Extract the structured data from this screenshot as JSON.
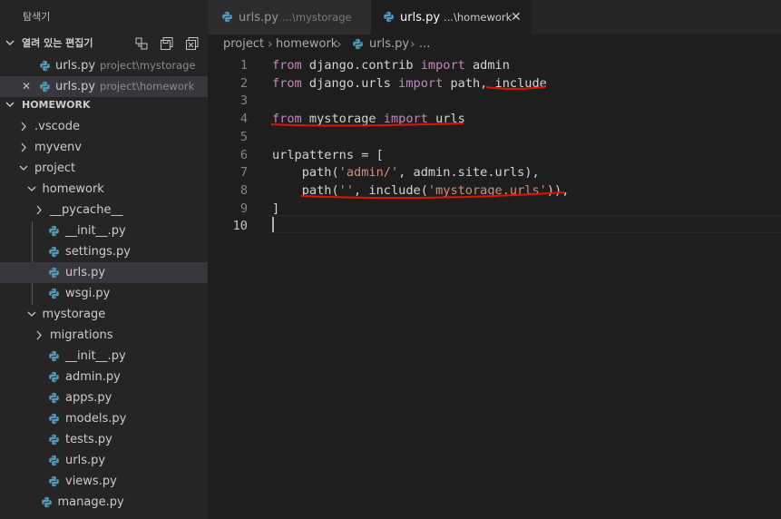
{
  "sidebar": {
    "title": "탐색기",
    "open_editors": {
      "header": "열려 있는 편집기",
      "header_icons": [
        "new-untitled-file-icon",
        "save-all-icon",
        "close-all-icon"
      ],
      "items": [
        {
          "name": "urls.py",
          "description": "project\\mystorage"
        },
        {
          "name": "urls.py",
          "description": "project\\homework",
          "close": "✕"
        }
      ]
    },
    "workspace": {
      "header": "HOMEWORK",
      "tree": [
        {
          "label": ".vscode",
          "type": "folder",
          "expanded": false
        },
        {
          "label": "myvenv",
          "type": "folder",
          "expanded": false
        },
        {
          "label": "project",
          "type": "folder",
          "expanded": true
        },
        {
          "label": "homework",
          "type": "folder",
          "expanded": true
        },
        {
          "label": "__pycache__",
          "type": "folder",
          "expanded": false
        },
        {
          "label": "__init__.py",
          "type": "file"
        },
        {
          "label": "settings.py",
          "type": "file"
        },
        {
          "label": "urls.py",
          "type": "file",
          "selected": true
        },
        {
          "label": "wsgi.py",
          "type": "file"
        },
        {
          "label": "mystorage",
          "type": "folder",
          "expanded": true
        },
        {
          "label": "migrations",
          "type": "folder",
          "expanded": false
        },
        {
          "label": "__init__.py",
          "type": "file"
        },
        {
          "label": "admin.py",
          "type": "file"
        },
        {
          "label": "apps.py",
          "type": "file"
        },
        {
          "label": "models.py",
          "type": "file"
        },
        {
          "label": "tests.py",
          "type": "file"
        },
        {
          "label": "urls.py",
          "type": "file"
        },
        {
          "label": "views.py",
          "type": "file"
        },
        {
          "label": "manage.py",
          "type": "file"
        }
      ]
    }
  },
  "tabs": [
    {
      "name": "urls.py",
      "description": "...\\mystorage",
      "active": false
    },
    {
      "name": "urls.py",
      "description": "...\\homework",
      "active": true,
      "close": "✕"
    }
  ],
  "breadcrumb": {
    "items": [
      "project",
      "homework",
      "urls.py",
      "..."
    ],
    "separator": "›"
  },
  "editor": {
    "active_line": 10,
    "lines": [
      {
        "n": "1",
        "tokens": [
          [
            "kw",
            "from"
          ],
          [
            "t",
            " django.contrib "
          ],
          [
            "kw",
            "import"
          ],
          [
            "t",
            " admin"
          ]
        ]
      },
      {
        "n": "2",
        "tokens": [
          [
            "kw",
            "from"
          ],
          [
            "t",
            " django.urls "
          ],
          [
            "kw",
            "import"
          ],
          [
            "t",
            " path, include"
          ]
        ]
      },
      {
        "n": "3",
        "tokens": []
      },
      {
        "n": "4",
        "tokens": [
          [
            "kw",
            "from"
          ],
          [
            "t",
            " mystorage "
          ],
          [
            "kw",
            "import"
          ],
          [
            "t",
            " urls"
          ]
        ]
      },
      {
        "n": "5",
        "tokens": []
      },
      {
        "n": "6",
        "tokens": [
          [
            "t",
            "urlpatterns = ["
          ]
        ]
      },
      {
        "n": "7",
        "tokens": [
          [
            "t",
            "    path("
          ],
          [
            "str",
            "'admin/'"
          ],
          [
            "t",
            ", admin.site.urls),"
          ]
        ]
      },
      {
        "n": "8",
        "tokens": [
          [
            "t",
            "    path("
          ],
          [
            "str",
            "''"
          ],
          [
            "t",
            ", include("
          ],
          [
            "str",
            "'mystorage.urls'"
          ],
          [
            "t",
            ")),"
          ]
        ]
      },
      {
        "n": "9",
        "tokens": [
          [
            "t",
            "]"
          ]
        ]
      },
      {
        "n": "10",
        "tokens": []
      }
    ],
    "annotations": "red handwritten underlines on line 2 'include', line 4 entire statement, line 8 path(...) call"
  },
  "colors": {
    "background": "#1e1e1e",
    "sidebar": "#252526",
    "keyword": "#c586c0",
    "string": "#ce9178",
    "text": "#d4d4d4",
    "python_icon": "#519aba",
    "annotation_red": "#e51400"
  }
}
